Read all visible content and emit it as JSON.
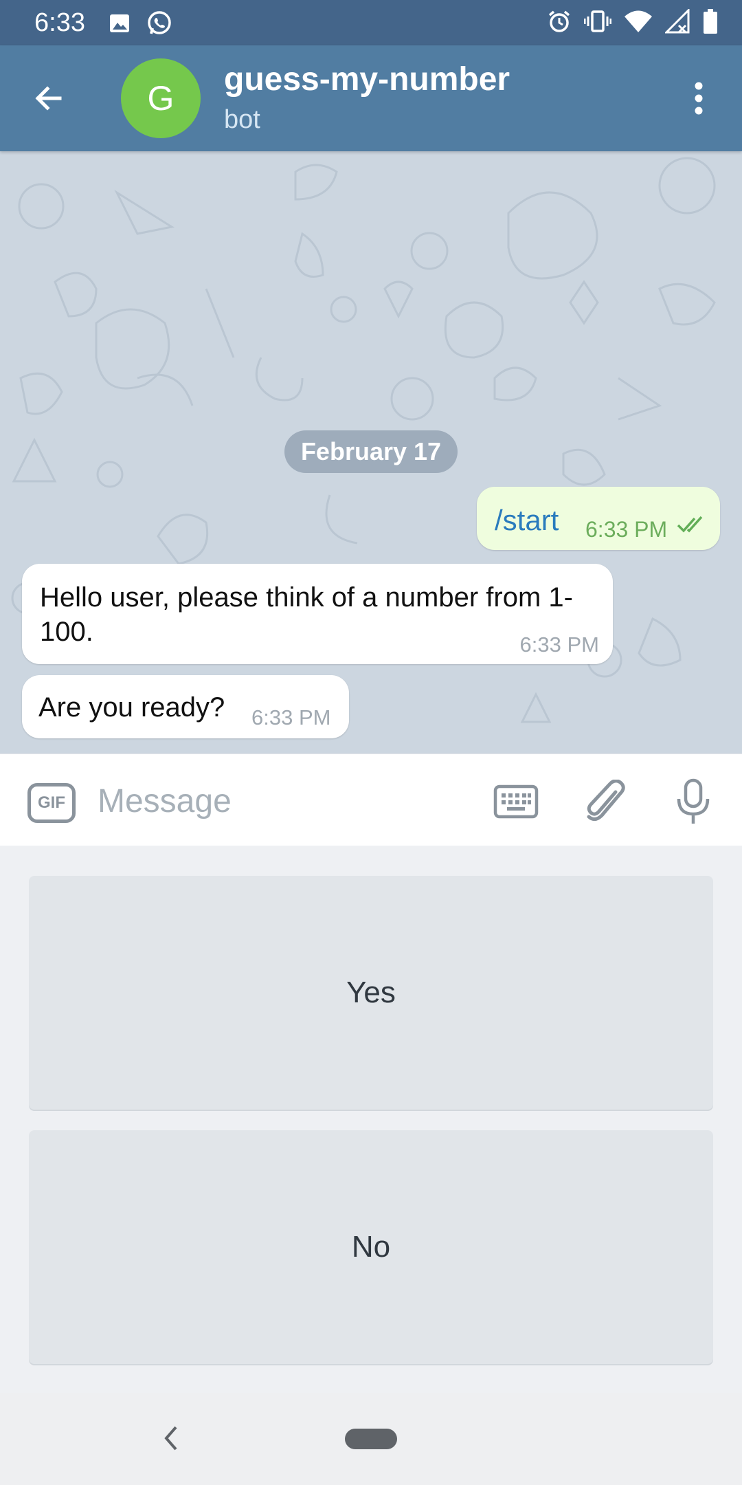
{
  "status_bar": {
    "time": "6:33",
    "left_icons": [
      "image-icon",
      "whatsapp-icon"
    ],
    "right_icons": [
      "alarm-icon",
      "vibrate-icon",
      "wifi-icon",
      "signal-icon",
      "battery-icon"
    ]
  },
  "header": {
    "avatar_letter": "G",
    "title": "guess-my-number",
    "subtitle": "bot",
    "colors": {
      "bar": "#517da2",
      "avatar": "#75c84c"
    }
  },
  "chat": {
    "date_separator": "February 17",
    "messages": [
      {
        "direction": "out",
        "text": "/start",
        "time": "6:33 PM",
        "status": "read"
      },
      {
        "direction": "in",
        "text": "Hello user, please think of a number from 1-100.",
        "time": "6:33 PM"
      },
      {
        "direction": "in",
        "text": "Are you ready?",
        "time": "6:33 PM"
      }
    ]
  },
  "composer": {
    "gif_label": "GIF",
    "placeholder": "Message",
    "icons": [
      "keyboard-icon",
      "paperclip-icon",
      "microphone-icon"
    ]
  },
  "bot_keyboard": {
    "buttons": [
      "Yes",
      "No"
    ]
  },
  "nav_bar": {
    "icons": [
      "back-chevron-icon",
      "home-pill-icon"
    ]
  }
}
